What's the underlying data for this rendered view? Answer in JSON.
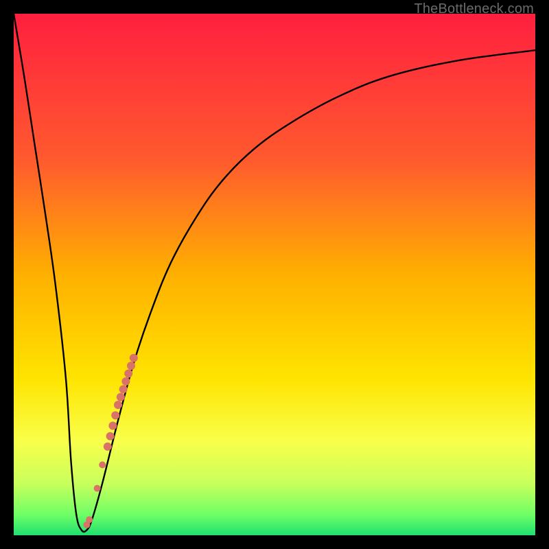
{
  "attribution": "TheBottleneck.com",
  "chart_data": {
    "type": "line",
    "title": "",
    "xlabel": "",
    "ylabel": "",
    "xlim": [
      0,
      100
    ],
    "ylim": [
      0,
      100
    ],
    "gradient_stops": [
      {
        "offset": 0,
        "color": "#ff1f3f"
      },
      {
        "offset": 28,
        "color": "#ff5a2e"
      },
      {
        "offset": 50,
        "color": "#ffb000"
      },
      {
        "offset": 70,
        "color": "#ffe400"
      },
      {
        "offset": 82,
        "color": "#f8ff4a"
      },
      {
        "offset": 90,
        "color": "#c9ff5c"
      },
      {
        "offset": 96,
        "color": "#6fff66"
      },
      {
        "offset": 100,
        "color": "#1fe070"
      }
    ],
    "series": [
      {
        "name": "bottleneck-curve",
        "x": [
          0,
          2,
          4,
          6,
          8,
          10,
          11,
          12,
          13,
          14,
          15,
          17,
          20,
          23,
          26,
          30,
          35,
          40,
          46,
          53,
          62,
          72,
          85,
          100
        ],
        "y": [
          100,
          88,
          75,
          62,
          48,
          30,
          14,
          4,
          1,
          1,
          3,
          10,
          22,
          33,
          42,
          52,
          61,
          68,
          74,
          79,
          84,
          88,
          91,
          93
        ]
      }
    ],
    "markers": {
      "name": "highlighted-points",
      "color": "#d97367",
      "points": [
        {
          "x": 14.0,
          "y": 2.0,
          "r": 5
        },
        {
          "x": 14.5,
          "y": 3.0,
          "r": 5
        },
        {
          "x": 16.0,
          "y": 9.0,
          "r": 5
        },
        {
          "x": 17.0,
          "y": 13.5,
          "r": 5
        },
        {
          "x": 18.0,
          "y": 17.0,
          "r": 6
        },
        {
          "x": 18.5,
          "y": 19.0,
          "r": 6
        },
        {
          "x": 19.0,
          "y": 21.0,
          "r": 6
        },
        {
          "x": 19.5,
          "y": 23.0,
          "r": 6
        },
        {
          "x": 20.0,
          "y": 25.0,
          "r": 6
        },
        {
          "x": 20.5,
          "y": 26.5,
          "r": 6
        },
        {
          "x": 21.0,
          "y": 28.0,
          "r": 6
        },
        {
          "x": 21.5,
          "y": 29.5,
          "r": 6
        },
        {
          "x": 22.0,
          "y": 31.0,
          "r": 6
        },
        {
          "x": 22.5,
          "y": 32.5,
          "r": 6
        },
        {
          "x": 23.0,
          "y": 34.0,
          "r": 6
        }
      ]
    }
  }
}
